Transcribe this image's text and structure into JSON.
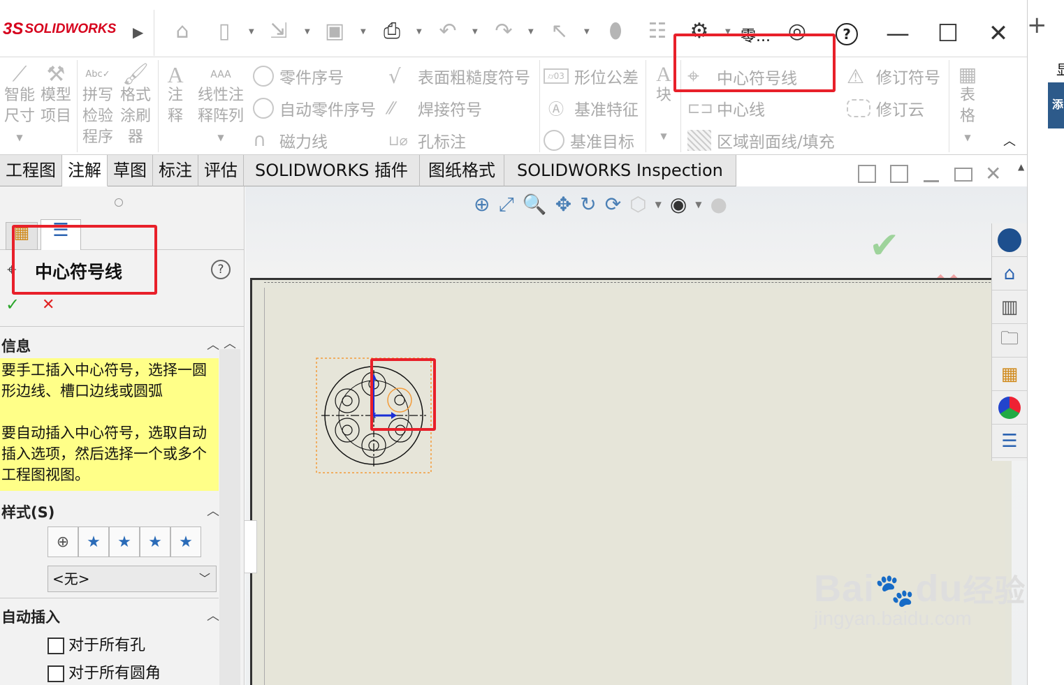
{
  "app": {
    "logo_text": "SOLIDWORKS",
    "logo_mark": "3S",
    "title_short": "零..."
  },
  "toolbar": {
    "icons": [
      "home-icon",
      "new-file-icon",
      "open-icon",
      "save-icon",
      "print-icon",
      "undo-icon",
      "redo-icon",
      "select-icon",
      "rebuild-icon",
      "file-properties-icon",
      "options-icon",
      "user-icon",
      "help-icon"
    ],
    "minimize": "—",
    "maximize": "☐",
    "close": "✕",
    "add_tab": "+"
  },
  "ribbon": {
    "smart_dim": [
      "智能",
      "尺寸"
    ],
    "model_items": [
      "模型",
      "项目"
    ],
    "spell_check": [
      "拼写",
      "检验",
      "程序"
    ],
    "format_painter": [
      "格式",
      "涂刷",
      "器"
    ],
    "note": [
      "注",
      "释"
    ],
    "linear_note": [
      "线性注",
      "释阵列"
    ],
    "balloon": "零件序号",
    "auto_balloon": "自动零件序号",
    "magnetic_line": "磁力线",
    "surface_finish": "表面粗糙度符号",
    "weld_symbol": "焊接符号",
    "hole_callout": "孔标注",
    "gtol": "形位公差",
    "datum_feature": "基准特征",
    "datum_target": "基准目标",
    "block": "块",
    "center_mark": "中心符号线",
    "centerline": "中心线",
    "area_hatch": "区域剖面线/填充",
    "revision_symbol": "修订符号",
    "revision_cloud": "修订云",
    "table": [
      "表",
      "格"
    ]
  },
  "tabs": [
    "工程图",
    "注解",
    "草图",
    "标注",
    "评估",
    "SOLIDWORKS 插件",
    "图纸格式",
    "SOLIDWORKS Inspection"
  ],
  "active_tab": 1,
  "panel": {
    "title": "中心符号线",
    "help": "?",
    "ok": "✓",
    "cancel": "✕",
    "info_header": "信息",
    "info_text_1": "要手工插入中心符号，选择一圆形边线、槽口边线或圆弧",
    "info_text_2": "要自动插入中心符号，选取自动插入选项，然后选择一个或多个工程图视图。",
    "style_header": "样式(S)",
    "style_select": "<无>",
    "auto_insert_header": "自动插入",
    "checkbox_1": "对于所有孔",
    "checkbox_2": "对于所有圆角"
  },
  "watermark": {
    "brand": "Bai",
    "brand2": "du",
    "cn": "经验",
    "url": "jingyan.baidu.com"
  },
  "rightstrip": {
    "char1": "显",
    "char2": "添"
  }
}
